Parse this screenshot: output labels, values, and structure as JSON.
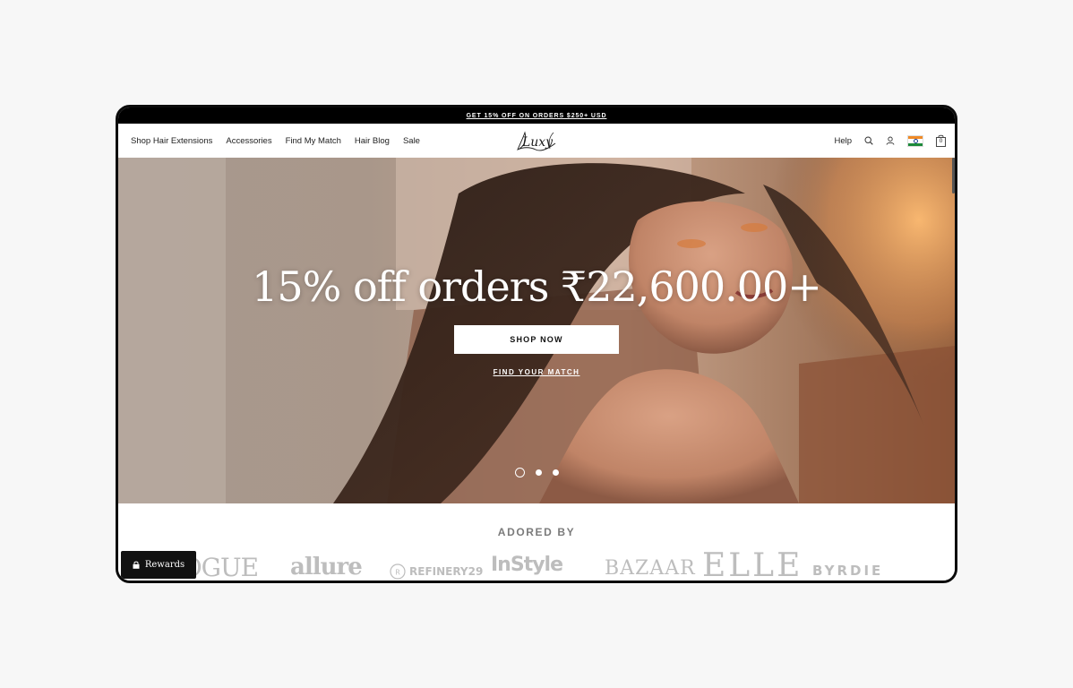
{
  "promo": {
    "text": "GET 15% OFF ON ORDERS $250+ USD"
  },
  "nav": {
    "links": [
      "Shop Hair Extensions",
      "Accessories",
      "Find My Match",
      "Hair Blog",
      "Sale"
    ],
    "logo_text": "Luxy",
    "help": "Help",
    "cart_count": "0",
    "icons": [
      "search-icon",
      "account-icon",
      "india-flag-icon",
      "bag-icon"
    ]
  },
  "hero": {
    "headline": "15% off orders ₹22,600.00+",
    "cta_label": "SHOP NOW",
    "secondary_link": "FIND YOUR MATCH",
    "slides": 3,
    "active_slide": 1
  },
  "adored": {
    "title": "ADORED BY",
    "brands": [
      "VOGUE",
      "allure",
      "REFINERY29",
      "InStyle",
      "BAZAAR",
      "ELLE",
      "BYRDIE"
    ]
  },
  "rewards": {
    "label": "Rewards"
  },
  "colors": {
    "promo_bg": "#000000",
    "brand_logo_gray": "#bdbdbd",
    "rewards_bg": "#111111"
  }
}
